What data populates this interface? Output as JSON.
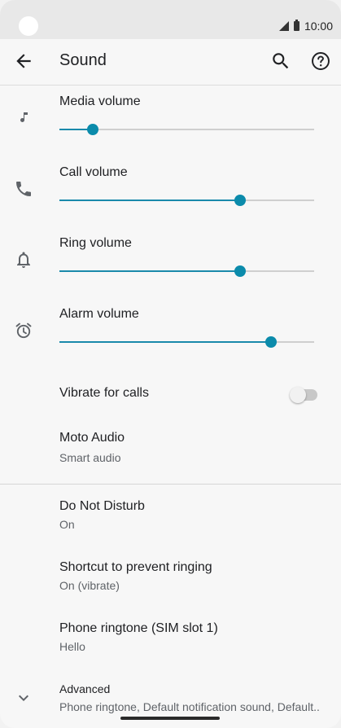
{
  "status_bar": {
    "time": "10:00"
  },
  "app_bar": {
    "title": "Sound",
    "back_icon": "arrow-back-icon",
    "search_icon": "search-icon",
    "help_icon": "help-icon"
  },
  "volumes": [
    {
      "label": "Media volume",
      "icon": "music-note-icon",
      "level": 0.13
    },
    {
      "label": "Call volume",
      "icon": "phone-icon",
      "level": 0.71
    },
    {
      "label": "Ring volume",
      "icon": "bell-icon",
      "level": 0.71
    },
    {
      "label": "Alarm volume",
      "icon": "alarm-icon",
      "level": 0.83
    }
  ],
  "vibrate": {
    "label": "Vibrate for calls",
    "enabled": false
  },
  "moto_audio": {
    "title": "Moto Audio",
    "subtitle": "Smart audio"
  },
  "settings": [
    {
      "title": "Do Not Disturb",
      "subtitle": "On"
    },
    {
      "title": "Shortcut to prevent ringing",
      "subtitle": "On (vibrate)"
    },
    {
      "title": "Phone ringtone (SIM slot 1)",
      "subtitle": "Hello"
    }
  ],
  "advanced": {
    "title": "Advanced",
    "subtitle": "Phone ringtone, Default notification sound, Default..",
    "icon": "chevron-down-icon"
  },
  "colors": {
    "accent": "#0b8bab",
    "background": "#f7f7f7"
  }
}
